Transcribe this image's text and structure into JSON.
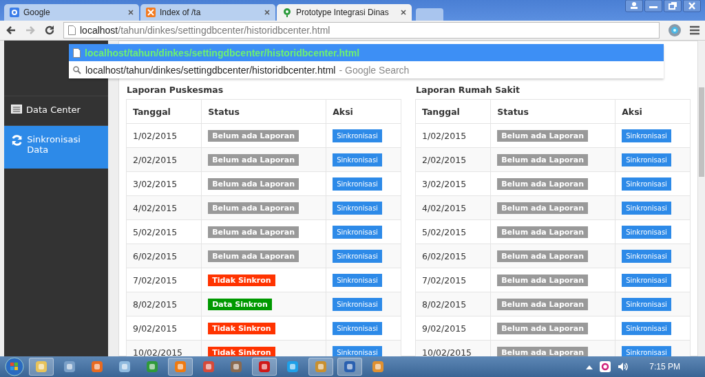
{
  "browser": {
    "tabs": [
      {
        "title": "Google",
        "selected": false
      },
      {
        "title": "Index of /ta",
        "selected": false
      },
      {
        "title": "Prototype Integrasi Dinas",
        "selected": true
      }
    ],
    "address": {
      "host": "localhost",
      "path": "/tahun/dinkes/settingdbcenter/historidbcenter.html"
    },
    "suggestions": [
      {
        "kind": "page",
        "text": "localhost/tahun/dinkes/settingdbcenter/historidbcenter.html",
        "selected": true
      },
      {
        "kind": "search",
        "text": "localhost/tahun/dinkes/settingdbcenter/historidbcenter.html",
        "suffix": "- Google Search",
        "selected": false
      }
    ]
  },
  "sidebar": {
    "items": [
      {
        "label": "Data Center",
        "selected": false
      },
      {
        "label": "Sinkronisasi Data",
        "selected": true
      }
    ]
  },
  "tables": [
    {
      "title": "Laporan Puskesmas",
      "columns": [
        "Tanggal",
        "Status",
        "Aksi"
      ],
      "rows": [
        {
          "date": "1/02/2015",
          "status": "Belum ada Laporan",
          "kind": "none",
          "action": "Sinkronisasi"
        },
        {
          "date": "2/02/2015",
          "status": "Belum ada Laporan",
          "kind": "none",
          "action": "Sinkronisasi"
        },
        {
          "date": "3/02/2015",
          "status": "Belum ada Laporan",
          "kind": "none",
          "action": "Sinkronisasi"
        },
        {
          "date": "4/02/2015",
          "status": "Belum ada Laporan",
          "kind": "none",
          "action": "Sinkronisasi"
        },
        {
          "date": "5/02/2015",
          "status": "Belum ada Laporan",
          "kind": "none",
          "action": "Sinkronisasi"
        },
        {
          "date": "6/02/2015",
          "status": "Belum ada Laporan",
          "kind": "none",
          "action": "Sinkronisasi"
        },
        {
          "date": "7/02/2015",
          "status": "Tidak Sinkron",
          "kind": "unsynced",
          "action": "Sinkronisasi"
        },
        {
          "date": "8/02/2015",
          "status": "Data Sinkron",
          "kind": "synced",
          "action": "Sinkronisasi"
        },
        {
          "date": "9/02/2015",
          "status": "Tidak Sinkron",
          "kind": "unsynced",
          "action": "Sinkronisasi"
        },
        {
          "date": "10/02/2015",
          "status": "Tidak Sinkron",
          "kind": "unsynced",
          "action": "Sinkronisasi"
        }
      ]
    },
    {
      "title": "Laporan Rumah Sakit",
      "columns": [
        "Tanggal",
        "Status",
        "Aksi"
      ],
      "rows": [
        {
          "date": "1/02/2015",
          "status": "Belum ada Laporan",
          "kind": "none",
          "action": "Sinkronisasi"
        },
        {
          "date": "2/02/2015",
          "status": "Belum ada Laporan",
          "kind": "none",
          "action": "Sinkronisasi"
        },
        {
          "date": "3/02/2015",
          "status": "Belum ada Laporan",
          "kind": "none",
          "action": "Sinkronisasi"
        },
        {
          "date": "4/02/2015",
          "status": "Belum ada Laporan",
          "kind": "none",
          "action": "Sinkronisasi"
        },
        {
          "date": "5/02/2015",
          "status": "Belum ada Laporan",
          "kind": "none",
          "action": "Sinkronisasi"
        },
        {
          "date": "6/02/2015",
          "status": "Belum ada Laporan",
          "kind": "none",
          "action": "Sinkronisasi"
        },
        {
          "date": "7/02/2015",
          "status": "Belum ada Laporan",
          "kind": "none",
          "action": "Sinkronisasi"
        },
        {
          "date": "8/02/2015",
          "status": "Belum ada Laporan",
          "kind": "none",
          "action": "Sinkronisasi"
        },
        {
          "date": "9/02/2015",
          "status": "Belum ada Laporan",
          "kind": "none",
          "action": "Sinkronisasi"
        },
        {
          "date": "10/02/2015",
          "status": "Belum ada Laporan",
          "kind": "none",
          "action": "Sinkronisasi"
        }
      ]
    }
  ],
  "taskbar": {
    "clock": "7:15 PM"
  }
}
